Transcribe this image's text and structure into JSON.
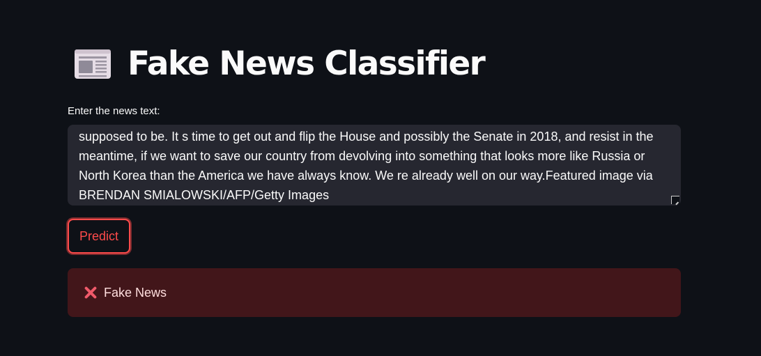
{
  "page": {
    "title": "Fake News Classifier",
    "title_icon": "newspaper-icon"
  },
  "input": {
    "label": "Enter the news text:",
    "value": "supposed to be. It s time to get out and flip the House and possibly the Senate in 2018, and resist in the meantime, if we want to save our country from devolving into something that looks more like Russia or North Korea than the America we have always know. We re already well on our way.Featured image via BRENDAN SMIALOWSKI/AFP/Getty Images"
  },
  "actions": {
    "predict_label": "Predict"
  },
  "result": {
    "icon": "cross-mark-icon",
    "text": "Fake News"
  },
  "colors": {
    "background": "#0e1117",
    "accent": "#ff4b4b",
    "input_background": "#262730",
    "error_background": "#3e2428"
  }
}
